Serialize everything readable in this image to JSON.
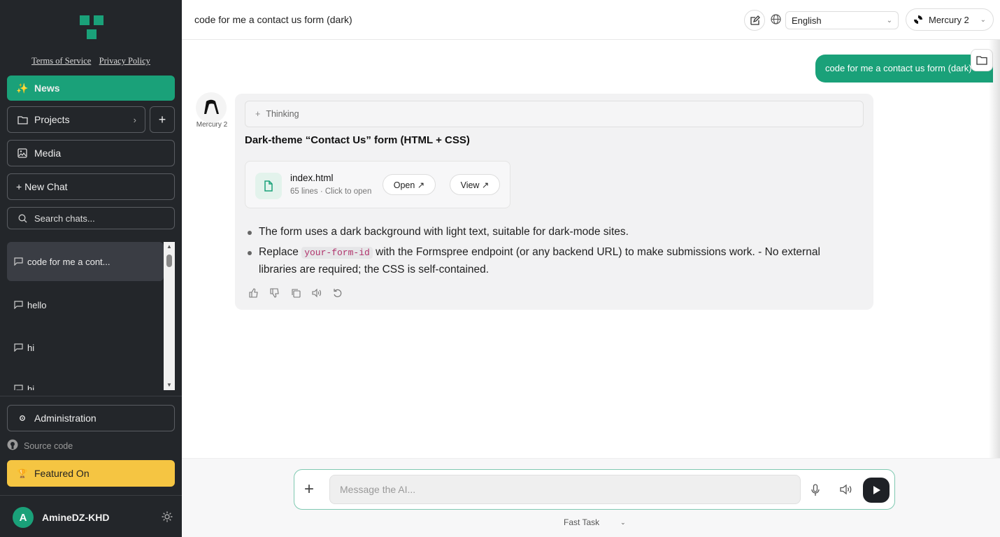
{
  "sidebar": {
    "legal": {
      "terms": "Terms of Service",
      "privacy": "Privacy Policy"
    },
    "news_label": "News",
    "projects_label": "Projects",
    "add_label": "+",
    "media_label": "Media",
    "new_chat_label": "+ New Chat",
    "search_placeholder": "Search chats...",
    "chats": [
      {
        "title": "code for me a cont..."
      },
      {
        "title": "hello"
      },
      {
        "title": "hi"
      },
      {
        "title": "hi"
      }
    ],
    "admin_label": "Administration",
    "source_label": "Source code",
    "featured_label": "Featured On",
    "user": {
      "initial": "A",
      "name": "AmineDZ-KHD"
    }
  },
  "header": {
    "title": "code for me a contact us form (dark)",
    "language": "English",
    "model": "Mercury 2"
  },
  "conversation": {
    "user_message": "code for me a contact us form (dark)",
    "bot_name": "Mercury 2",
    "thinking_label": "Thinking",
    "answer_title": "Dark-theme “Contact Us” form (HTML + CSS)",
    "file": {
      "name": "index.html",
      "meta": "65 lines · Click to open",
      "open_label": "Open ↗",
      "view_label": "View ↗"
    },
    "bullet1": "The form uses a dark background with light text, suitable for dark-mode sites.",
    "bullet2_pre": "Replace ",
    "bullet2_code": "your-form-id",
    "bullet2_post": " with the Formspree endpoint (or any backend URL) to make submissions work.  - No external libraries are required; the CSS is self-contained."
  },
  "composer": {
    "placeholder": "Message the AI...",
    "mode": "Fast Task"
  },
  "colors": {
    "accent": "#1aa179",
    "sidebar_bg": "#23262a",
    "featured": "#f5c542"
  }
}
